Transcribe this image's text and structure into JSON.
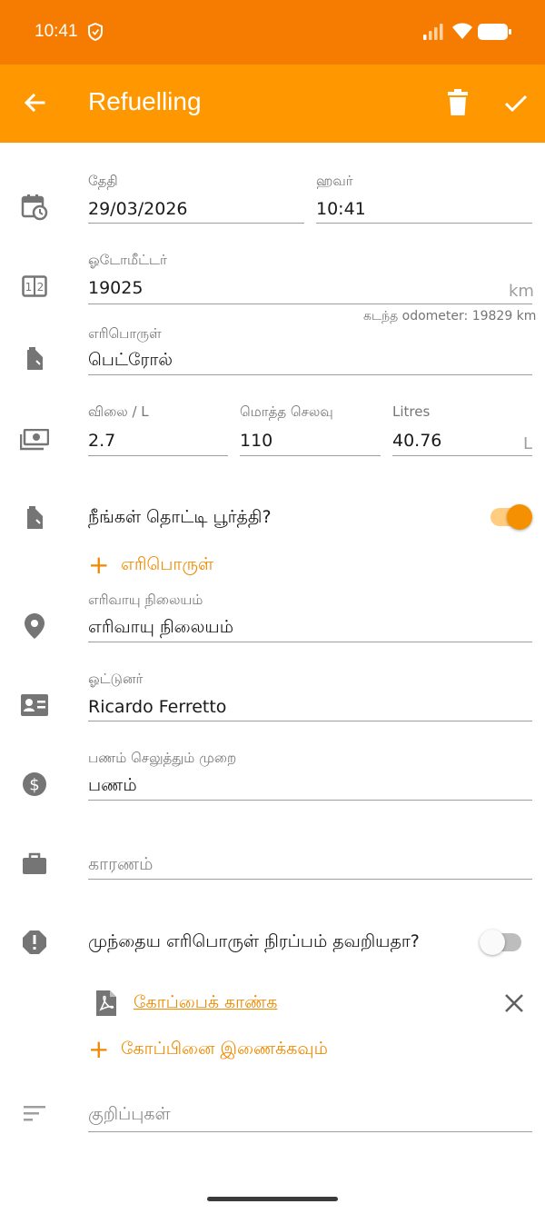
{
  "status_bar": {
    "time": "10:41"
  },
  "app_bar": {
    "title": "Refuelling"
  },
  "date": {
    "label": "தேதி",
    "value": "29/03/2026"
  },
  "time_field": {
    "label": "ஹவர்",
    "value": "10:41"
  },
  "odometer": {
    "label": "ஓடோமீட்டர்",
    "value": "19025",
    "unit": "km",
    "helper": "கடந்த odometer: 19829 km"
  },
  "fuel_type": {
    "label": "எரிபொருள்",
    "value": "பெட்ரோல்"
  },
  "price": {
    "label": "விலை / L",
    "value": "2.7"
  },
  "total_cost": {
    "label": "மொத்த செலவு",
    "value": "110"
  },
  "litres": {
    "label": "Litres",
    "value": "40.76",
    "unit": "L"
  },
  "full_tank": {
    "label": "நீங்கள் தொட்டி பூர்த்தி?",
    "checked": true
  },
  "add_fuel": {
    "label": "எரிபொருள்"
  },
  "station": {
    "label": "எரிவாயு நிலையம்",
    "value": "எரிவாயு நிலையம்"
  },
  "driver": {
    "label": "ஓட்டுனர்",
    "value": "Ricardo Ferretto"
  },
  "payment": {
    "label": "பணம் செலுத்தும் முறை",
    "value": "பணம்"
  },
  "reason": {
    "placeholder": "காரணம்"
  },
  "missed_previous": {
    "label": "முந்தைய எரிபொருள் நிரப்பம் தவறியதா?",
    "checked": false
  },
  "attachment": {
    "link_label": "கோப்பைக் காண்க"
  },
  "add_file": {
    "label": "கோப்பினை இணைக்கவும்"
  },
  "notes": {
    "placeholder": "குறிப்புகள்"
  },
  "colors": {
    "status_bar": "#f57c00",
    "app_bar": "#ff9800",
    "accent": "#ef8a00",
    "icon": "#757575"
  }
}
